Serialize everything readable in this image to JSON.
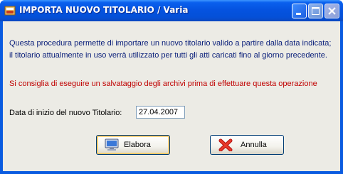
{
  "window": {
    "title": "IMPORTA NUOVO TITOLARIO / Varia"
  },
  "body": {
    "line1": "Questa procedura permette di importare un nuovo titolario valido a partire dalla data indicata;",
    "line2": "il titolario attualmente in uso verrà utilizzato per tutti gli atti caricati fino al giorno precedente.",
    "warning": "Si consiglia di eseguire un salvataggio degli archivi prima di effettuare questa operazione",
    "date_label": "Data di inizio del nuovo Titolario:",
    "date_value": "27.04.2007"
  },
  "buttons": {
    "elabora": "Elabora",
    "annulla": "Annulla"
  },
  "icons": {
    "app": "app-icon",
    "elabora": "monitor-icon",
    "annulla": "red-x-icon"
  }
}
